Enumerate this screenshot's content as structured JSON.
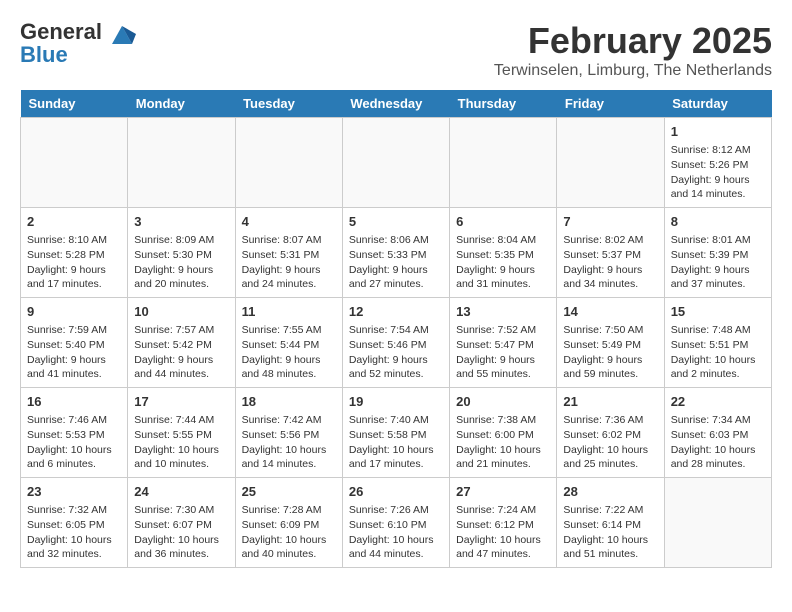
{
  "header": {
    "logo_line1": "General",
    "logo_line2": "Blue",
    "month": "February 2025",
    "location": "Terwinselen, Limburg, The Netherlands"
  },
  "days_of_week": [
    "Sunday",
    "Monday",
    "Tuesday",
    "Wednesday",
    "Thursday",
    "Friday",
    "Saturday"
  ],
  "weeks": [
    [
      {
        "day": "",
        "info": ""
      },
      {
        "day": "",
        "info": ""
      },
      {
        "day": "",
        "info": ""
      },
      {
        "day": "",
        "info": ""
      },
      {
        "day": "",
        "info": ""
      },
      {
        "day": "",
        "info": ""
      },
      {
        "day": "1",
        "info": "Sunrise: 8:12 AM\nSunset: 5:26 PM\nDaylight: 9 hours and 14 minutes."
      }
    ],
    [
      {
        "day": "2",
        "info": "Sunrise: 8:10 AM\nSunset: 5:28 PM\nDaylight: 9 hours and 17 minutes."
      },
      {
        "day": "3",
        "info": "Sunrise: 8:09 AM\nSunset: 5:30 PM\nDaylight: 9 hours and 20 minutes."
      },
      {
        "day": "4",
        "info": "Sunrise: 8:07 AM\nSunset: 5:31 PM\nDaylight: 9 hours and 24 minutes."
      },
      {
        "day": "5",
        "info": "Sunrise: 8:06 AM\nSunset: 5:33 PM\nDaylight: 9 hours and 27 minutes."
      },
      {
        "day": "6",
        "info": "Sunrise: 8:04 AM\nSunset: 5:35 PM\nDaylight: 9 hours and 31 minutes."
      },
      {
        "day": "7",
        "info": "Sunrise: 8:02 AM\nSunset: 5:37 PM\nDaylight: 9 hours and 34 minutes."
      },
      {
        "day": "8",
        "info": "Sunrise: 8:01 AM\nSunset: 5:39 PM\nDaylight: 9 hours and 37 minutes."
      }
    ],
    [
      {
        "day": "9",
        "info": "Sunrise: 7:59 AM\nSunset: 5:40 PM\nDaylight: 9 hours and 41 minutes."
      },
      {
        "day": "10",
        "info": "Sunrise: 7:57 AM\nSunset: 5:42 PM\nDaylight: 9 hours and 44 minutes."
      },
      {
        "day": "11",
        "info": "Sunrise: 7:55 AM\nSunset: 5:44 PM\nDaylight: 9 hours and 48 minutes."
      },
      {
        "day": "12",
        "info": "Sunrise: 7:54 AM\nSunset: 5:46 PM\nDaylight: 9 hours and 52 minutes."
      },
      {
        "day": "13",
        "info": "Sunrise: 7:52 AM\nSunset: 5:47 PM\nDaylight: 9 hours and 55 minutes."
      },
      {
        "day": "14",
        "info": "Sunrise: 7:50 AM\nSunset: 5:49 PM\nDaylight: 9 hours and 59 minutes."
      },
      {
        "day": "15",
        "info": "Sunrise: 7:48 AM\nSunset: 5:51 PM\nDaylight: 10 hours and 2 minutes."
      }
    ],
    [
      {
        "day": "16",
        "info": "Sunrise: 7:46 AM\nSunset: 5:53 PM\nDaylight: 10 hours and 6 minutes."
      },
      {
        "day": "17",
        "info": "Sunrise: 7:44 AM\nSunset: 5:55 PM\nDaylight: 10 hours and 10 minutes."
      },
      {
        "day": "18",
        "info": "Sunrise: 7:42 AM\nSunset: 5:56 PM\nDaylight: 10 hours and 14 minutes."
      },
      {
        "day": "19",
        "info": "Sunrise: 7:40 AM\nSunset: 5:58 PM\nDaylight: 10 hours and 17 minutes."
      },
      {
        "day": "20",
        "info": "Sunrise: 7:38 AM\nSunset: 6:00 PM\nDaylight: 10 hours and 21 minutes."
      },
      {
        "day": "21",
        "info": "Sunrise: 7:36 AM\nSunset: 6:02 PM\nDaylight: 10 hours and 25 minutes."
      },
      {
        "day": "22",
        "info": "Sunrise: 7:34 AM\nSunset: 6:03 PM\nDaylight: 10 hours and 28 minutes."
      }
    ],
    [
      {
        "day": "23",
        "info": "Sunrise: 7:32 AM\nSunset: 6:05 PM\nDaylight: 10 hours and 32 minutes."
      },
      {
        "day": "24",
        "info": "Sunrise: 7:30 AM\nSunset: 6:07 PM\nDaylight: 10 hours and 36 minutes."
      },
      {
        "day": "25",
        "info": "Sunrise: 7:28 AM\nSunset: 6:09 PM\nDaylight: 10 hours and 40 minutes."
      },
      {
        "day": "26",
        "info": "Sunrise: 7:26 AM\nSunset: 6:10 PM\nDaylight: 10 hours and 44 minutes."
      },
      {
        "day": "27",
        "info": "Sunrise: 7:24 AM\nSunset: 6:12 PM\nDaylight: 10 hours and 47 minutes."
      },
      {
        "day": "28",
        "info": "Sunrise: 7:22 AM\nSunset: 6:14 PM\nDaylight: 10 hours and 51 minutes."
      },
      {
        "day": "",
        "info": ""
      }
    ]
  ]
}
